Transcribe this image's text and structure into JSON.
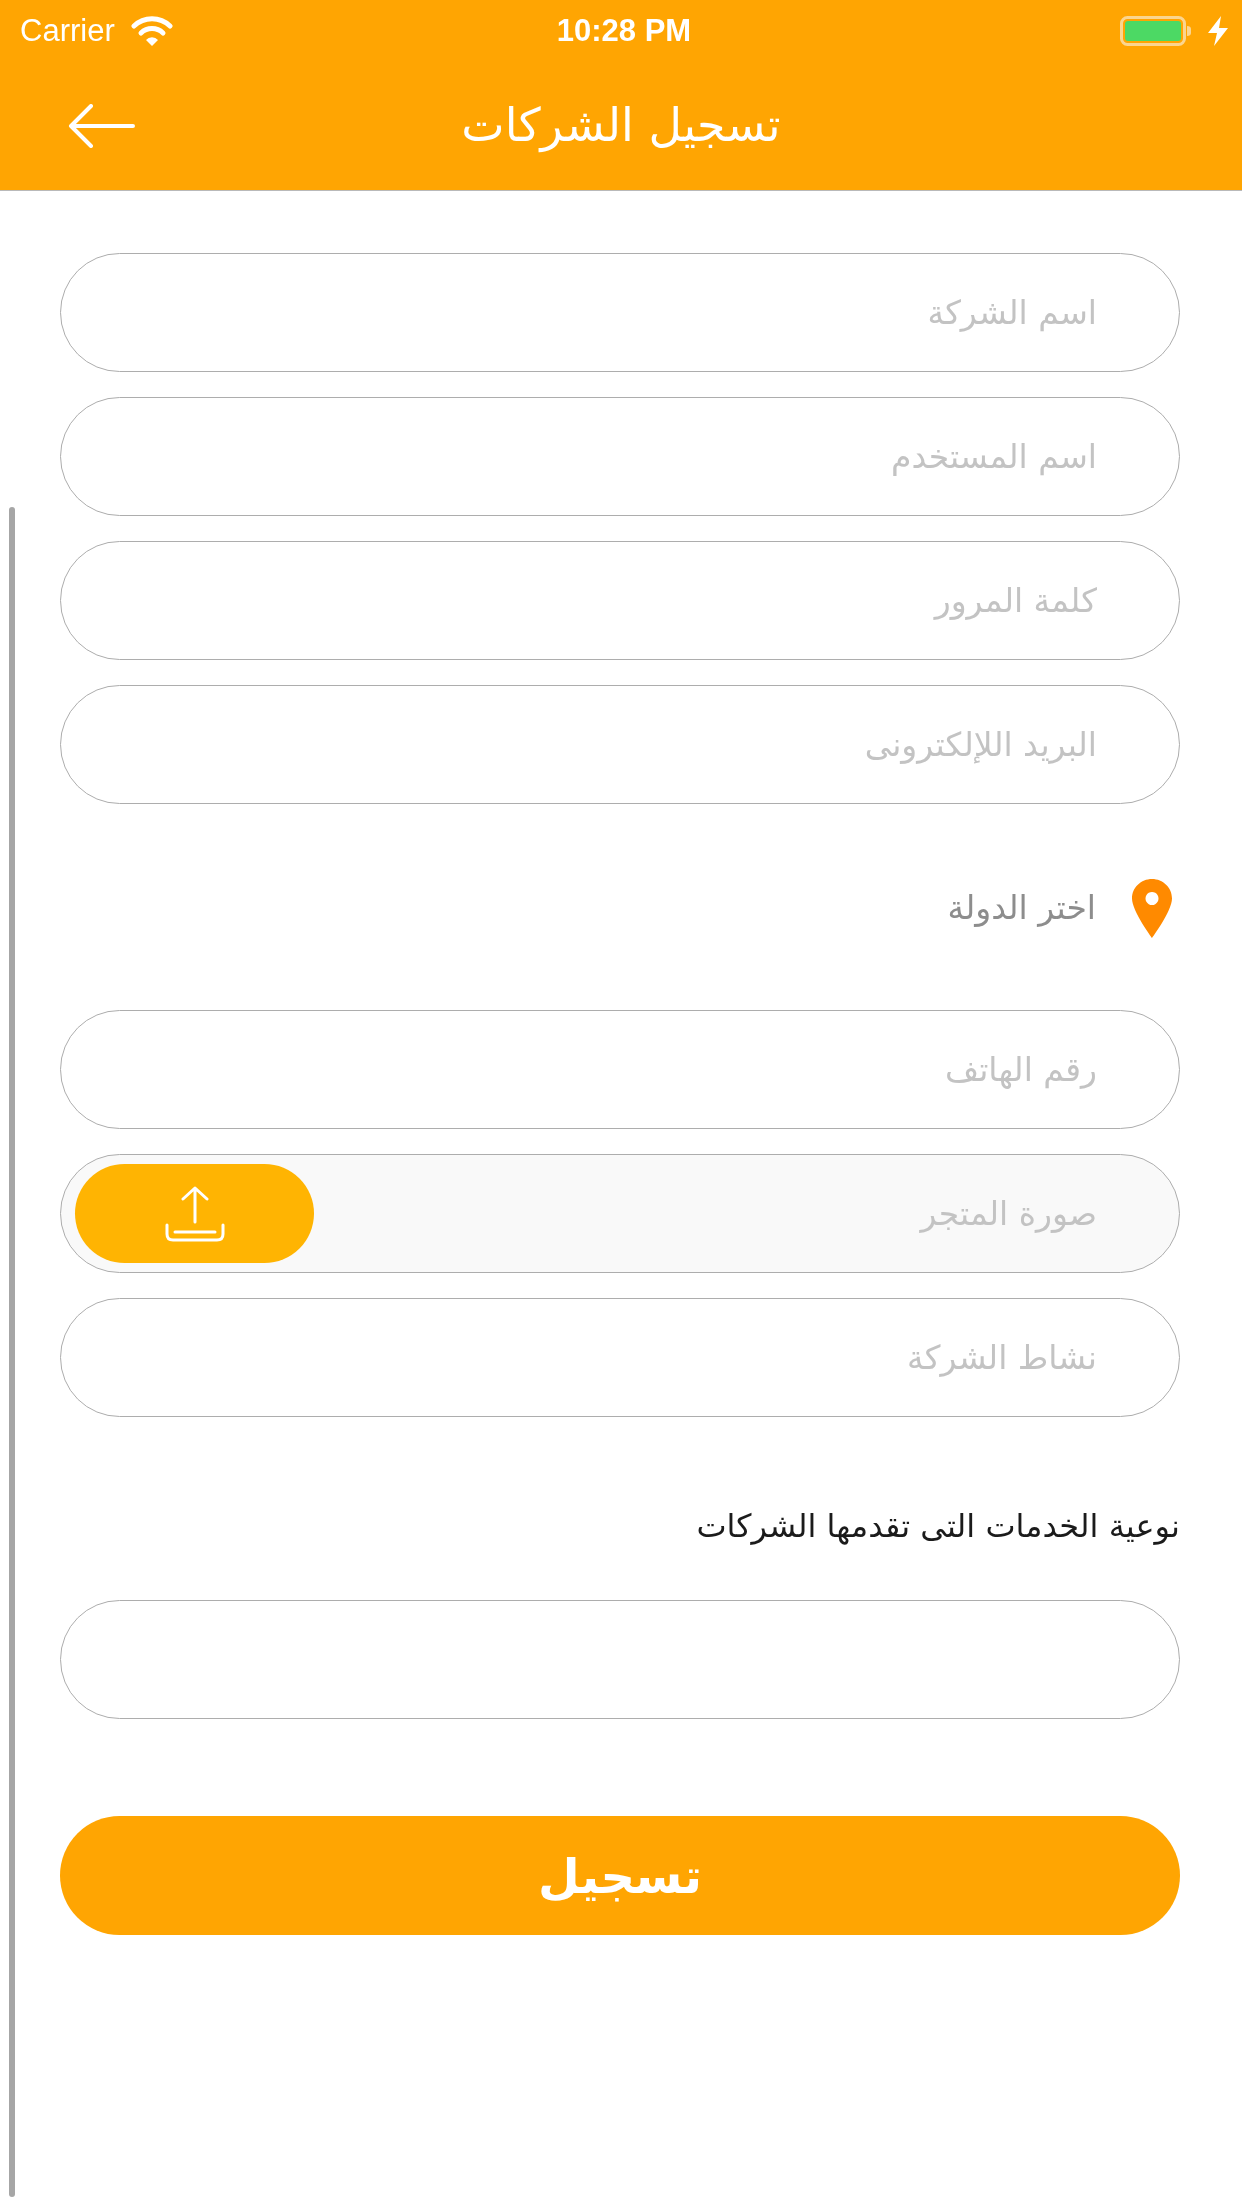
{
  "status_bar": {
    "carrier": "Carrier",
    "time": "10:28 PM"
  },
  "header": {
    "title": "تسجيل الشركات"
  },
  "form": {
    "items": [
      {
        "kind": "text",
        "placeholder": "اسم الشركة"
      },
      {
        "kind": "text",
        "placeholder": "اسم المستخدم"
      },
      {
        "kind": "text",
        "placeholder": "كلمة المرور"
      },
      {
        "kind": "text",
        "placeholder": "البريد اللإلكترونى"
      },
      {
        "kind": "location",
        "label": "اختر الدولة"
      },
      {
        "kind": "text",
        "placeholder": "رقم الهاتف"
      },
      {
        "kind": "upload",
        "placeholder": "صورة المتجر"
      },
      {
        "kind": "text",
        "placeholder": "نشاط الشركة"
      },
      {
        "kind": "heading",
        "label": "نوعية الخدمات التى تقدمها الشركات"
      },
      {
        "kind": "text"
      }
    ]
  },
  "submit_button": {
    "label": "تسجيل"
  }
}
